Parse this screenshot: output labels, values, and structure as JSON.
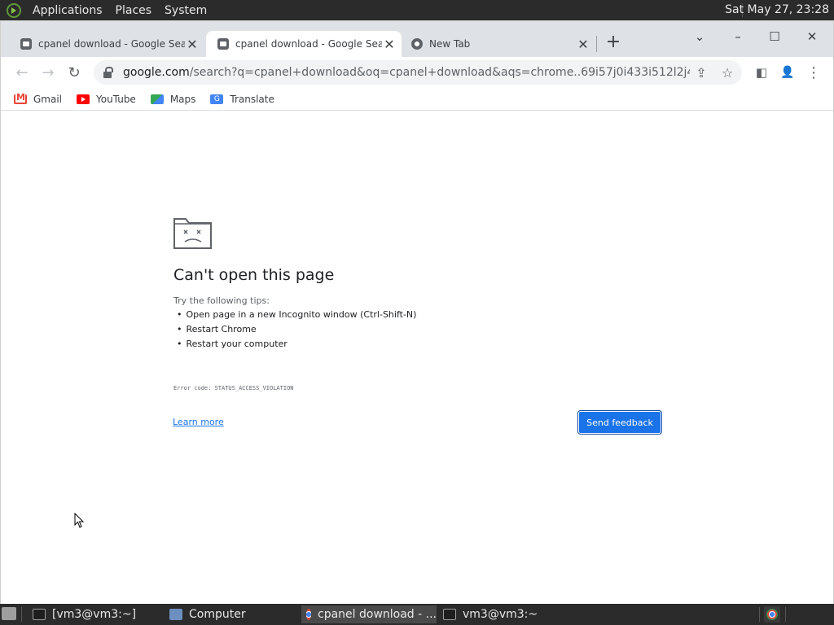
{
  "top_panel": {
    "menus": [
      "Applications",
      "Places",
      "System"
    ],
    "clock": "Sat May 27, 23:28"
  },
  "browser": {
    "tabs": [
      {
        "title": "cpanel download - Google Search",
        "icon": "doc-icon"
      },
      {
        "title": "cpanel download - Google Search",
        "icon": "doc-icon",
        "active": true
      },
      {
        "title": "New Tab",
        "icon": "chrome-icon"
      }
    ],
    "new_tab_label": "+",
    "window_controls": {
      "tab_search": "⌄",
      "minimize": "–",
      "maximize": "☐",
      "close": "✕"
    },
    "toolbar": {
      "back": "←",
      "forward": "→",
      "reload": "↻",
      "url_host": "google.com",
      "url_rest": "/search?q=cpanel+download&oq=cpanel+download&aqs=chrome..69i57j0i433i512l2j46i131i199i4...",
      "share": "⇪",
      "star": "☆",
      "side_panel": "◧",
      "profile": "👤",
      "menu": "⋮"
    },
    "bookmarks": [
      {
        "label": "Gmail",
        "icon": "gmail-icon"
      },
      {
        "label": "YouTube",
        "icon": "youtube-icon"
      },
      {
        "label": "Maps",
        "icon": "maps-icon"
      },
      {
        "label": "Translate",
        "icon": "translate-icon"
      }
    ]
  },
  "error_page": {
    "title": "Can't open this page",
    "tips_intro": "Try the following tips:",
    "tips": [
      "Open page in a new Incognito window (Ctrl-Shift-N)",
      "Restart Chrome",
      "Restart your computer"
    ],
    "error_code": "Error code: STATUS_ACCESS_VIOLATION",
    "learn_more": "Learn more",
    "feedback_button": "Send feedback"
  },
  "taskbar": {
    "tasks": [
      {
        "label": "[vm3@vm3:~]",
        "icon": "terminal-icon"
      },
      {
        "label": "Computer",
        "icon": "computer-icon"
      },
      {
        "label": "cpanel download - ...",
        "icon": "chrome-icon",
        "active": true
      },
      {
        "label": "vm3@vm3:~",
        "icon": "terminal-icon"
      }
    ]
  }
}
